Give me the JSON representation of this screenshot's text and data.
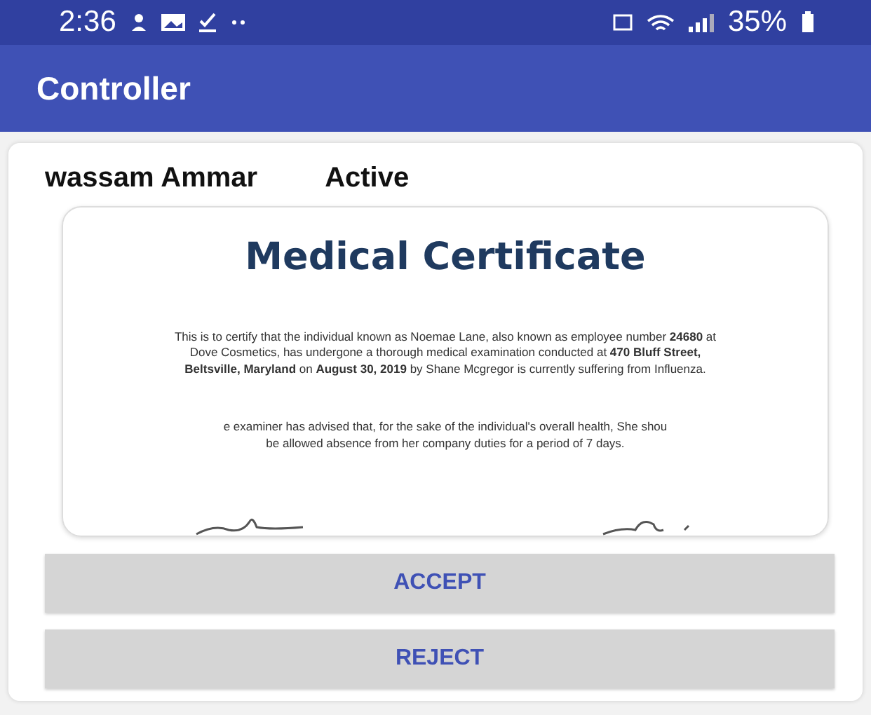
{
  "status_bar": {
    "time": "2:36",
    "battery": "35%"
  },
  "app_bar": {
    "title": "Controller"
  },
  "request": {
    "name": "wassam Ammar",
    "status": "Active"
  },
  "certificate": {
    "title": "Medical Certificate",
    "paragraphs": [
      "This is to certify that the individual known as Noemae Lane, also known as employee number **24680** at Dove Cosmetics, has undergone a thorough medical examination conducted at **470 Bluff Street, Beltsville, Maryland** on **August 30, 2019** by Shane Mcgregor is currently suffering from Influenza."
    ],
    "cut_lines": [
      "e examiner has advised that, for the sake of the individual's overall health, She shou",
      "be allowed absence from her company duties for a period of 7 days."
    ]
  },
  "buttons": [
    "ACCEPT",
    "REJECT"
  ]
}
